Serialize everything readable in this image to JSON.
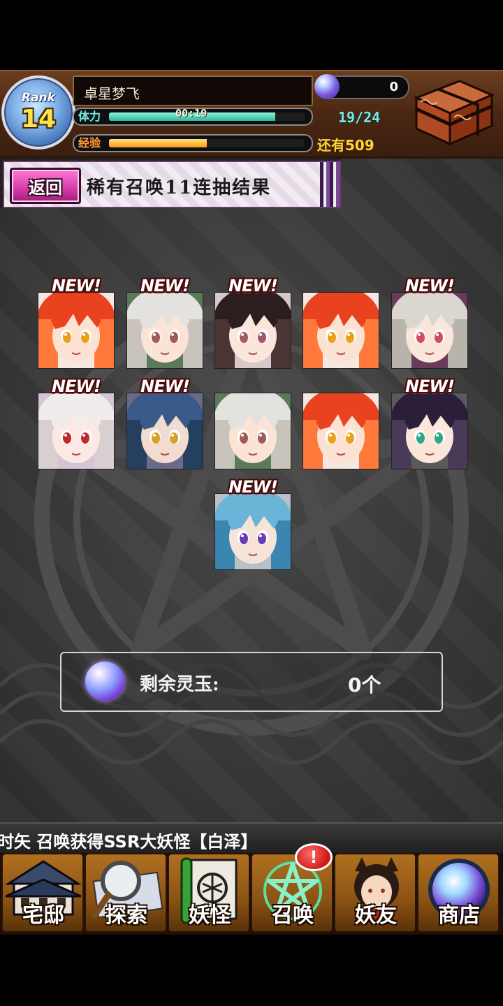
{
  "header": {
    "rank_label": "Rank",
    "rank_value": "14",
    "player_name": "卓星梦飞",
    "stamina_label": "体力",
    "stamina_timer": "00:19",
    "stamina_fill_fraction": 0.85,
    "stamina_count": "19/24",
    "exp_label": "经验",
    "exp_fill_fraction": 0.5,
    "exp_remaining": "还有509",
    "orb_count": "0"
  },
  "title_bar": {
    "back_label": "返回",
    "title": "稀有召唤11连抽结果"
  },
  "results": {
    "new_label": "NEW!",
    "cards": [
      {
        "name": "card-red-hair-girl",
        "is_new": true,
        "palette": "red"
      },
      {
        "name": "card-white-hair-girl",
        "is_new": true,
        "palette": "white"
      },
      {
        "name": "card-black-hair-girl",
        "is_new": true,
        "palette": "black"
      },
      {
        "name": "card-red-hair-girl",
        "is_new": false,
        "palette": "red"
      },
      {
        "name": "card-frog-hat-girl",
        "is_new": true,
        "palette": "frog"
      },
      {
        "name": "card-white-haired-red-eyes",
        "is_new": true,
        "palette": "pale"
      },
      {
        "name": "card-blue-hair-boy",
        "is_new": true,
        "palette": "navy"
      },
      {
        "name": "card-white-hair-girl",
        "is_new": false,
        "palette": "white"
      },
      {
        "name": "card-red-hair-girl",
        "is_new": false,
        "palette": "red"
      },
      {
        "name": "card-dark-hair-green-eyes",
        "is_new": true,
        "palette": "dark"
      },
      {
        "name": "card-light-blue-hair-boy",
        "is_new": true,
        "palette": "cyan"
      }
    ]
  },
  "orb_panel": {
    "label": "剩余灵玉:",
    "value": "0个"
  },
  "ticker": {
    "text": "时矢 召唤获得SSR大妖怪【白泽】"
  },
  "nav": {
    "items": [
      {
        "label": "宅邸",
        "icon": "mansion-icon"
      },
      {
        "label": "探索",
        "icon": "magnifier-map-icon"
      },
      {
        "label": "妖怪",
        "icon": "scroll-icon"
      },
      {
        "label": "召唤",
        "icon": "pentagram-icon"
      },
      {
        "label": "妖友",
        "icon": "catgirl-icon"
      },
      {
        "label": "商店",
        "icon": "crystal-orb-icon"
      }
    ],
    "summon_alert": "!"
  },
  "colors": {
    "header_brown": "#4a2712",
    "stamina_teal": "#7ee6e0",
    "exp_orange": "#ff9a1a",
    "title_magenta": "#d63aa6"
  }
}
